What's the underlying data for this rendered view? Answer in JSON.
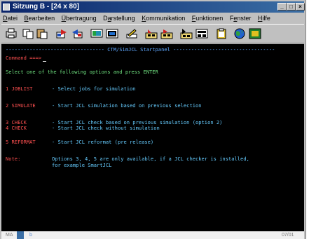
{
  "window": {
    "title": "Sitzung B - [24 x 80]"
  },
  "menu": [
    {
      "label": "Datei",
      "u": "D"
    },
    {
      "label": "Bearbeiten",
      "u": "B"
    },
    {
      "label": "Übertragung",
      "u": "Ü"
    },
    {
      "label": "Darstellung",
      "u": "a"
    },
    {
      "label": "Kommunikation",
      "u": "K"
    },
    {
      "label": "Funktionen",
      "u": "F"
    },
    {
      "label": "Fenster",
      "u": "e"
    },
    {
      "label": "Hilfe",
      "u": "H"
    }
  ],
  "toolbar": {
    "icons": [
      "print-icon",
      "copy-icon",
      "paste-icon",
      "send-file-icon",
      "receive-file-icon",
      "display-icon",
      "color-icon",
      "edit-icon",
      "macro-record-icon",
      "macro-play-icon",
      "macro-stop-icon",
      "macro-edit-icon",
      "clipboard-icon",
      "globe-icon",
      "app-icon"
    ]
  },
  "terminal": {
    "header": "--------------------------------- CTM/SimJCL Startpanel ----------------------------------",
    "command_label": "Command ===>",
    "prompt": "Select one of the following options and press ENTER",
    "options": [
      {
        "key": "1 JOBLIST",
        "desc": "- Select jobs for simulation"
      },
      {
        "key": "2 SIMULATE",
        "desc": "- Start JCL simulation based on previous selection"
      },
      {
        "key": "3 CHECK",
        "desc": "- Start JCL check based on previous simulation (option 2)"
      },
      {
        "key": "4 CHECK",
        "desc": "- Start JCL check without simulation"
      },
      {
        "key": "5 REFORMAT",
        "desc": "- Start JCL reformat (pre release)"
      }
    ],
    "note_label": "Note:",
    "note_line1": "Options 3, 4, 5 are only available, if a JCL checker is installed,",
    "note_line2": "for example SmartJCL"
  },
  "statusbar": {
    "left": "MA",
    "mid": "b",
    "right": "07/01"
  },
  "colors": {
    "title_bar": "#0a246a",
    "terminal_bg": "#000000",
    "terminal_text": "#66ccff",
    "terminal_label": "#ff5050",
    "terminal_prompt": "#6fe07f"
  }
}
